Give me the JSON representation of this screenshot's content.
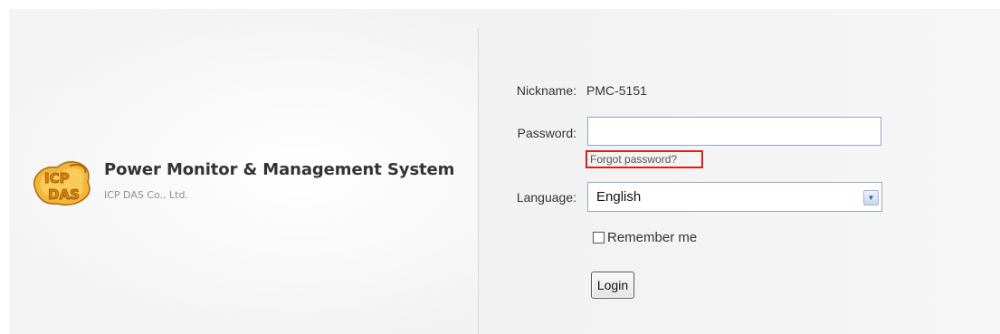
{
  "brand": {
    "title": "Power Monitor & Management System",
    "subtitle": "ICP DAS Co., Ltd.",
    "logo_icon": "icp-das-logo"
  },
  "form": {
    "nickname_label": "Nickname:",
    "nickname_value": "PMC-5151",
    "password_label": "Password:",
    "password_value": "",
    "forgot_password_text": "Forgot password?",
    "language_label": "Language:",
    "language_selected": "English",
    "remember_label": "Remember me",
    "remember_checked": false,
    "login_label": "Login"
  },
  "colors": {
    "highlight_border": "#d62020",
    "input_border": "#8fa9c9",
    "logo_orange": "#f0a020"
  }
}
